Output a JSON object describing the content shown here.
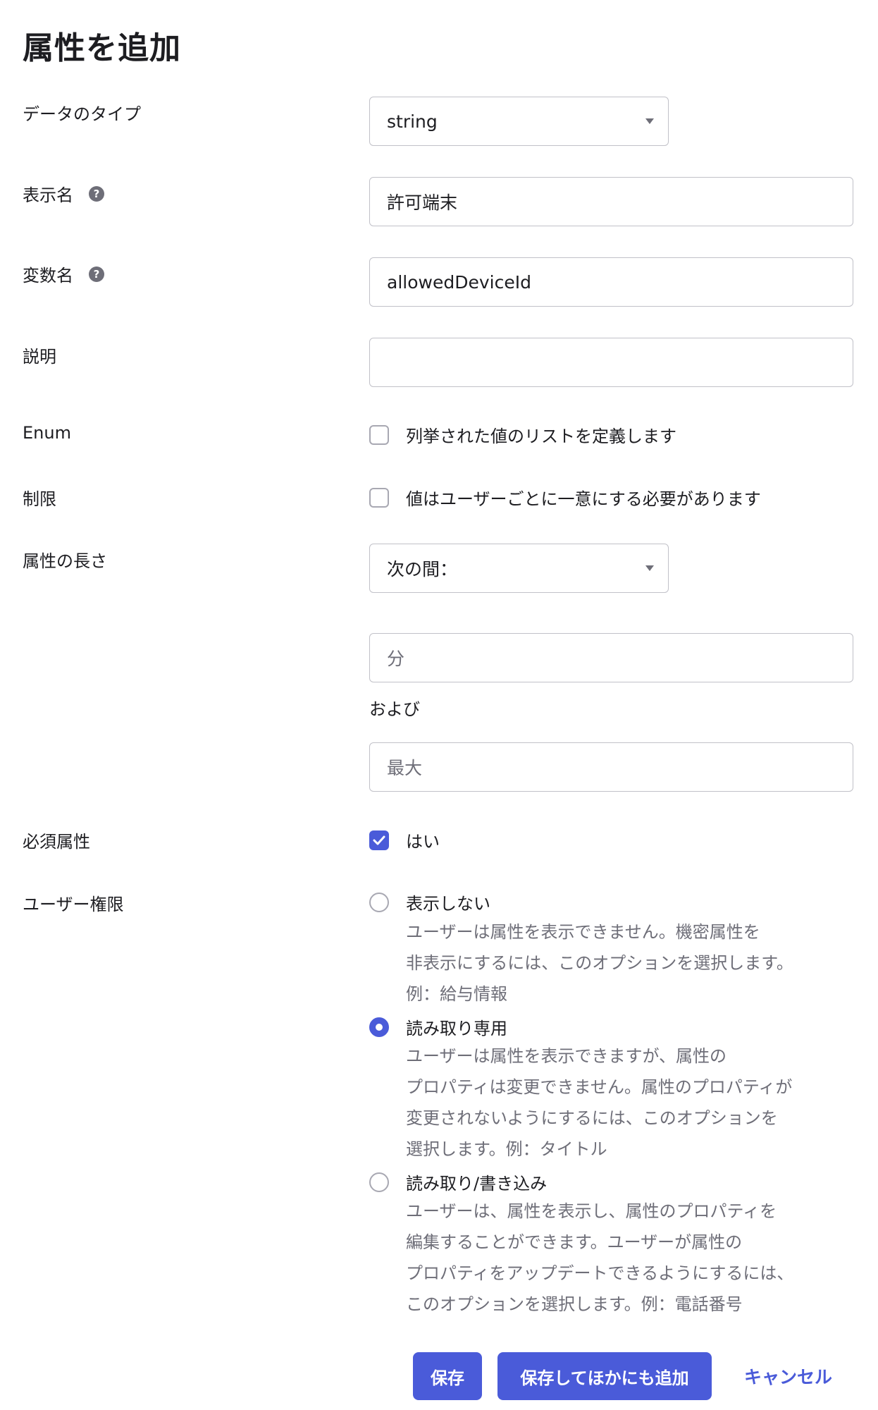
{
  "title": "属性を追加",
  "fields": {
    "data_type": {
      "label": "データのタイプ",
      "value": "string"
    },
    "display_name": {
      "label": "表示名",
      "value": "許可端末",
      "help": "?"
    },
    "variable_name": {
      "label": "変数名",
      "value": "allowedDeviceId",
      "help": "?"
    },
    "description": {
      "label": "説明",
      "value": ""
    },
    "enum": {
      "label": "Enum",
      "checkbox_label": "列挙された値のリストを定義します",
      "checked": false
    },
    "limit": {
      "label": "制限",
      "checkbox_label": "値はユーザーごとに一意にする必要があります",
      "checked": false
    },
    "length": {
      "label": "属性の長さ",
      "value": "次の間：",
      "min_placeholder": "分",
      "and_text": "および",
      "max_placeholder": "最大"
    },
    "required": {
      "label": "必須属性",
      "checkbox_label": "はい",
      "checked": true
    },
    "user_permission": {
      "label": "ユーザー権限",
      "options": [
        {
          "label": "表示しない",
          "selected": false,
          "description": "ユーザーは属性を表示できません。機密属性を\n非表示にするには、このオプションを選択します。\n例：給与情報"
        },
        {
          "label": "読み取り専用",
          "selected": true,
          "description": "ユーザーは属性を表示できますが、属性の\nプロパティは変更できません。属性のプロパティが\n変更されないようにするには、このオプションを\n選択します。例：タイトル"
        },
        {
          "label": "読み取り/書き込み",
          "selected": false,
          "description": "ユーザーは、属性を表示し、属性のプロパティを\n編集することができます。ユーザーが属性の\nプロパティをアップデートできるようにするには、\nこのオプションを選択します。例：電話番号"
        }
      ]
    }
  },
  "buttons": {
    "save": "保存",
    "save_and_add": "保存してほかにも追加",
    "cancel": "キャンセル"
  },
  "colors": {
    "accent": "#4a5bd9",
    "muted_text": "#6e6e78",
    "border": "#c1c1c8"
  }
}
